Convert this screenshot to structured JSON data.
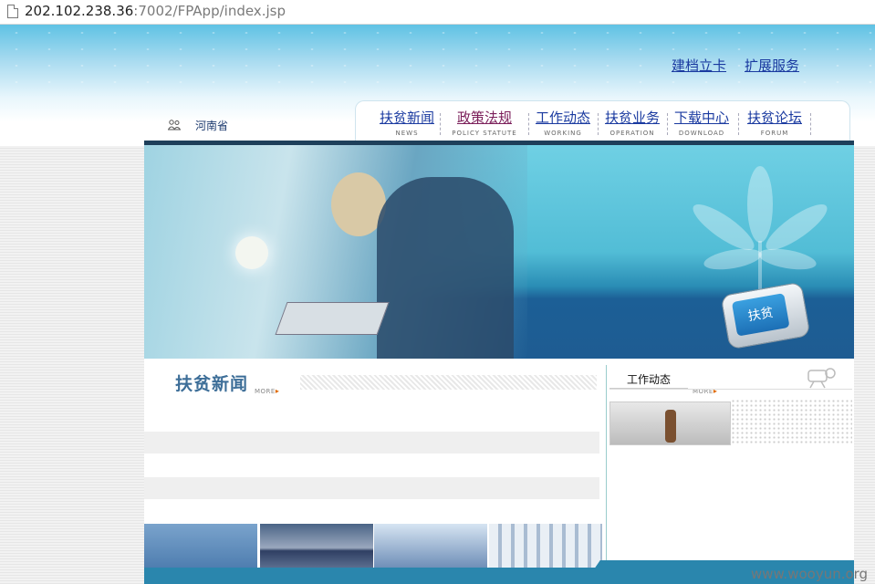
{
  "browser": {
    "url_host": "202.102.238.36",
    "url_rest": ":7002/FPApp/index.jsp"
  },
  "header": {
    "links": [
      "建档立卡",
      "扩展服务"
    ],
    "province": "河南省"
  },
  "nav": {
    "items": [
      {
        "zh": "扶贫新闻",
        "en": "NEWS"
      },
      {
        "zh": "政策法规",
        "en": "POLICY STATUTE"
      },
      {
        "zh": "工作动态",
        "en": "WORKING"
      },
      {
        "zh": "扶贫业务",
        "en": "OPERATION"
      },
      {
        "zh": "下载中心",
        "en": "DOWNLOAD"
      },
      {
        "zh": "扶贫论坛",
        "en": "FORUM"
      }
    ]
  },
  "banner": {
    "device_label": "扶贫"
  },
  "news": {
    "title": "扶贫新闻",
    "more": "MORE"
  },
  "work": {
    "title": "工作动态",
    "more": "MORE"
  },
  "watermark": "www.wooyun.org",
  "colors": {
    "link_blue": "#1a3aa0",
    "visited_purple": "#7b1f5a",
    "banner_teal": "#52bdd6",
    "nav_dark_line": "#1e3f5a",
    "bottom_bar": "#2a86ad"
  }
}
